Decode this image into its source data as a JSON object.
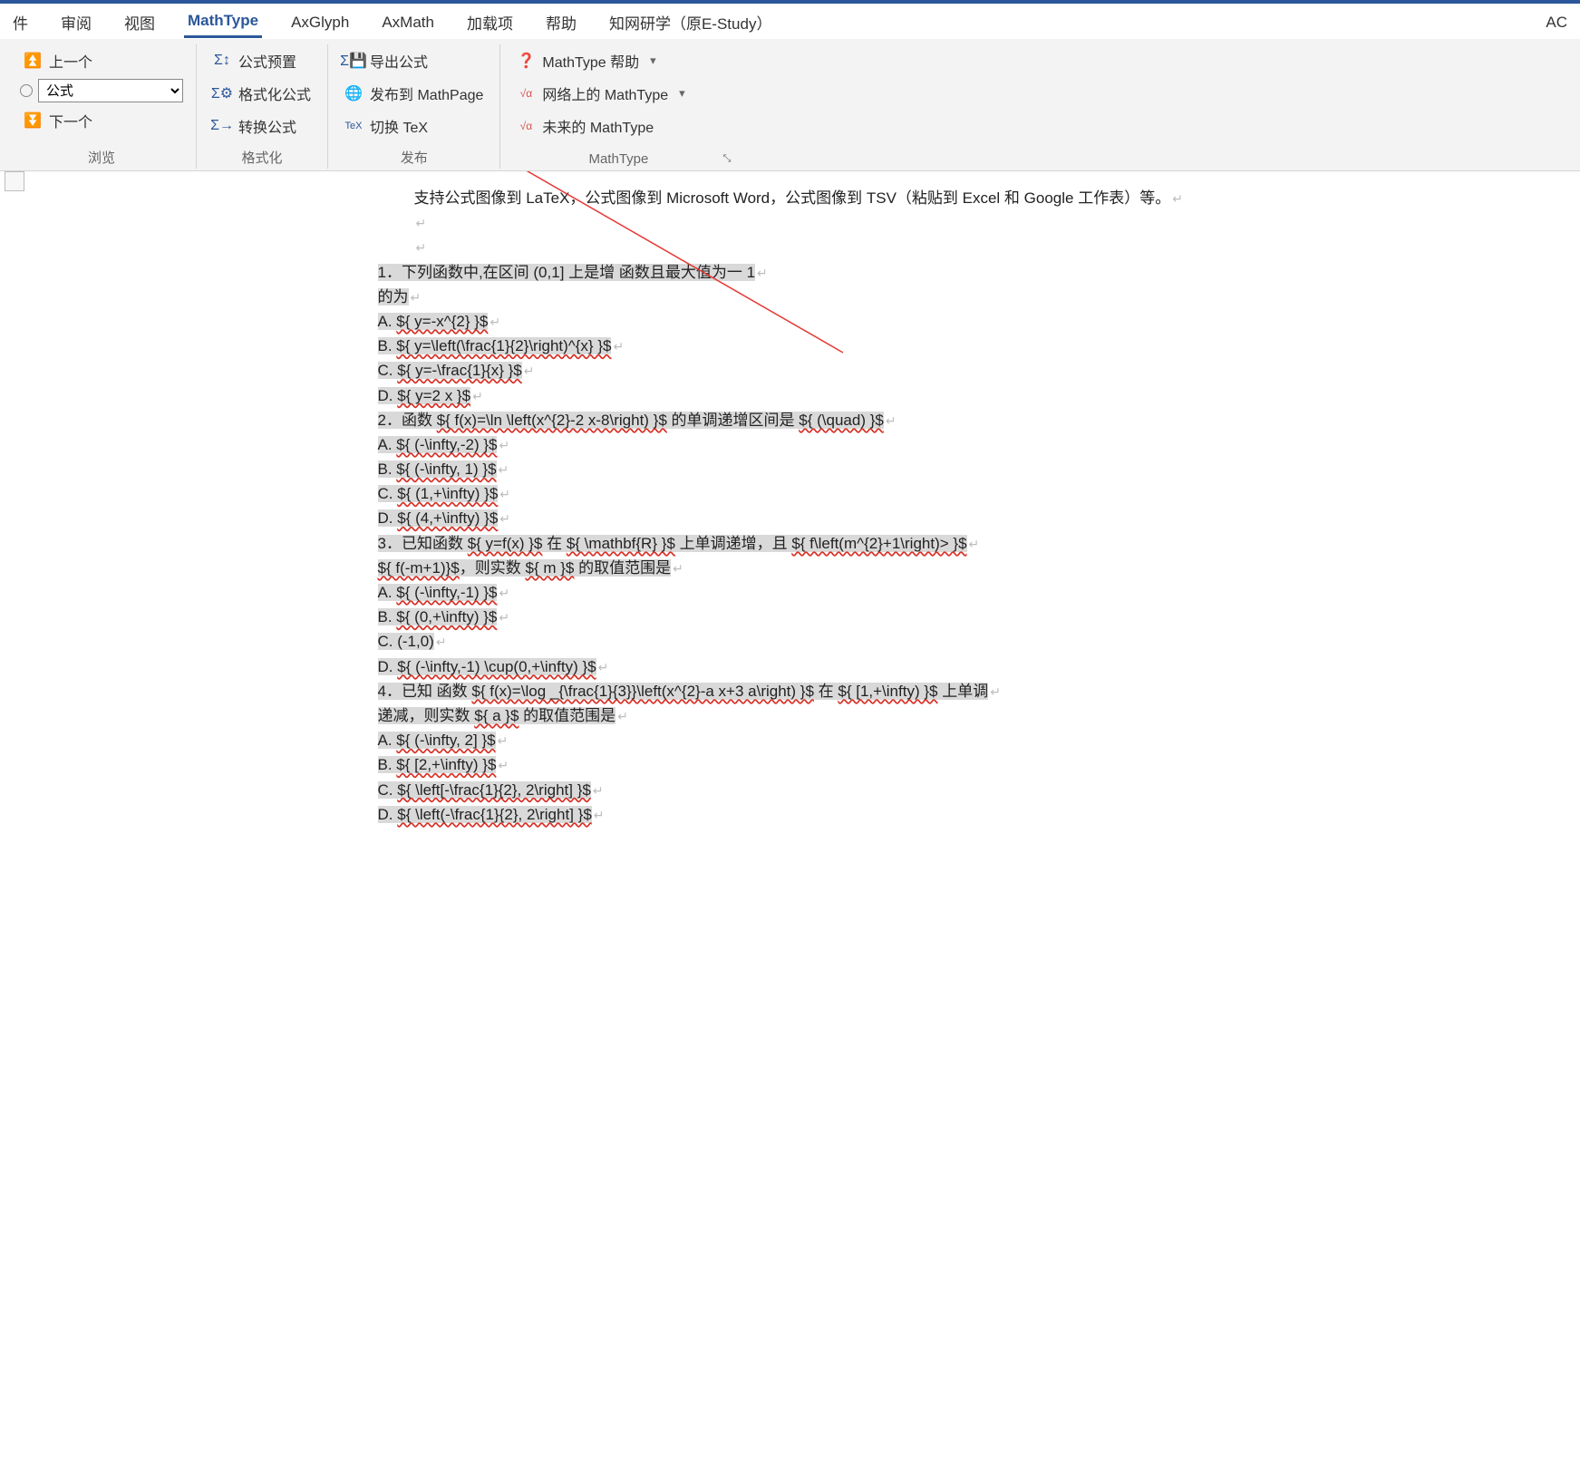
{
  "tabs": [
    "件",
    "审阅",
    "视图",
    "MathType",
    "AxGlyph",
    "AxMath",
    "加载项",
    "帮助",
    "知网研学（原E-Study）",
    "AC"
  ],
  "activeTab": "MathType",
  "ribbon": {
    "browse": {
      "prev": "上一个",
      "formula": "公式",
      "next": "下一个",
      "label": "浏览"
    },
    "format": {
      "presets": "公式预置",
      "formatEq": "格式化公式",
      "convert": "转换公式",
      "label": "格式化"
    },
    "publish": {
      "export": "导出公式",
      "mathpage": "发布到 MathPage",
      "tex": "切换 TeX",
      "label": "发布"
    },
    "mathtype": {
      "help": "MathType 帮助",
      "web": "网络上的 MathType",
      "future": "未来的 MathType",
      "label": "MathType"
    }
  },
  "doc": {
    "intro1": "支持公式图像到  LaTeX，公式图像到  Microsoft  Word，公式图像到  TSV（粘贴到  Excel  和  Google  工作表）等。",
    "lines": [
      "1．下列函数中,在区间  (0,1]  上是增  函数且最大值为一  1",
      "的为",
      "A. ${ y=-x^{2} }$",
      "B. ${ y=\\left(\\frac{1}{2}\\right)^{x} }$",
      "C. ${ y=-\\frac{1}{x} }$",
      "D. ${ y=2 x }$",
      "2．函数  ${ f(x)=\\ln \\left(x^{2}-2 x-8\\right) }$  的单调递增区间是  ${ (\\quad) }$",
      "A. ${ (-\\infty,-2) }$",
      "B. ${ (-\\infty, 1) }$",
      "C. ${ (1,+\\infty) }$",
      "D. ${ (4,+\\infty) }$",
      "3．已知函数  ${ y=f(x) }$  在  ${ \\mathbf{R} }$  上单调递增，且  ${ f\\left(m^{2}+1\\right)> }$",
      "${ f(-m+1)}$，则实数  ${ m }$  的取值范围是",
      "A. ${ (-\\infty,-1) }$",
      "B. ${ (0,+\\infty) }$",
      "C. (-1,0)",
      "D. ${ (-\\infty,-1) \\cup(0,+\\infty) }$",
      "4．已知  函数  ${ f(x)=\\log _{\\frac{1}{3}}\\left(x^{2}-a x+3 a\\right) }$  在  ${ [1,+\\infty) }$  上单调",
      "递减，则实数  ${ a }$  的取值范围是",
      "A. ${ (-\\infty, 2] }$",
      "B. ${ [2,+\\infty) }$",
      "C. ${ \\left[-\\frac{1}{2}, 2\\right] }$",
      "D. ${ \\left(-\\frac{1}{2}, 2\\right] }$"
    ]
  }
}
